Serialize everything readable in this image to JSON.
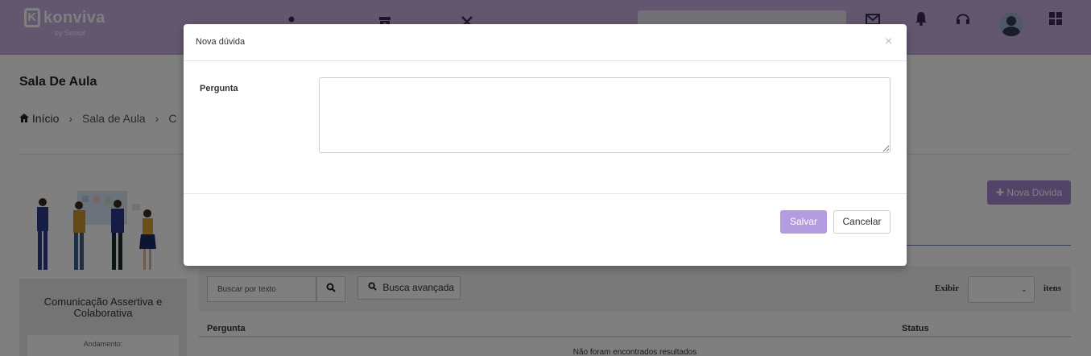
{
  "header": {
    "logo_text": "konviva",
    "logo_sub": "by Senior",
    "nav_icons": [
      "people-icon",
      "archive-icon",
      "tools-icon"
    ],
    "right_icons": [
      "mail-icon",
      "bell-icon",
      "headset-icon",
      "avatar",
      "apps-icon"
    ]
  },
  "page": {
    "title": "Sala De Aula",
    "breadcrumb": [
      "Início",
      "Sala de Aula",
      "C"
    ],
    "new_doubt_label": "Nova Dúvida",
    "course": {
      "name": "Comunicação Assertiva e Colaborativa",
      "progress_label": "Andamento:"
    },
    "filters": {
      "search_placeholder": "Buscar por texto",
      "advanced_label": "Busca avançada",
      "show_label": "Exibir",
      "items_label": "itens",
      "select_value": ""
    },
    "table": {
      "columns": [
        "Pergunta",
        "Status"
      ],
      "empty_text": "Não foram encontrados resultados"
    }
  },
  "modal": {
    "title": "Nova dúvida",
    "close_glyph": "×",
    "field_label": "Pergunta",
    "field_value": "",
    "save_label": "Salvar",
    "cancel_label": "Cancelar"
  },
  "colors": {
    "topbar": "#c6aee0",
    "accent": "#a987d1",
    "save_button": "#b59be0"
  }
}
